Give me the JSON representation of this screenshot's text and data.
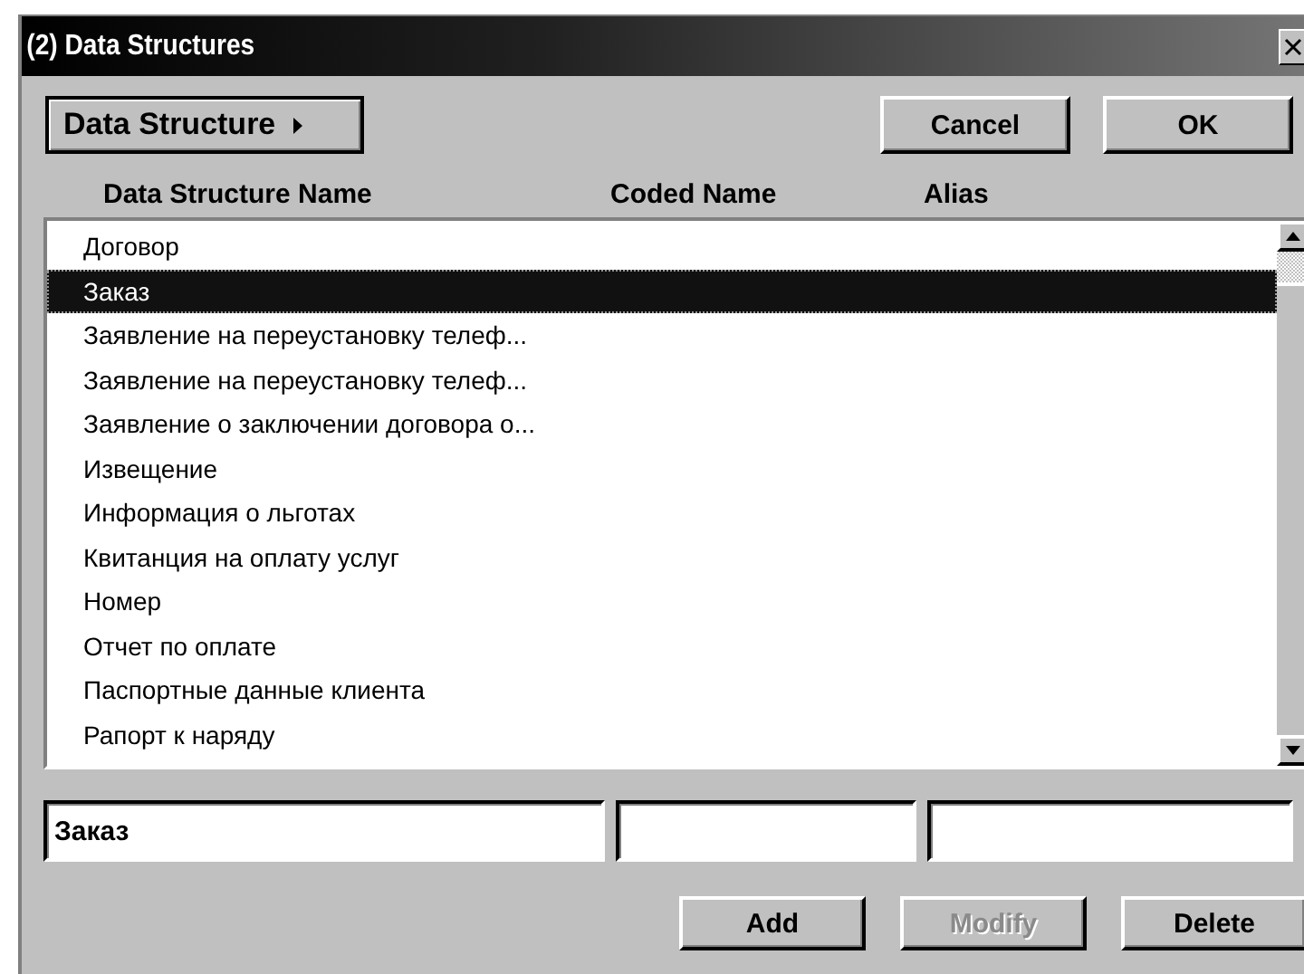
{
  "window": {
    "title": "(2) Data Structures"
  },
  "menu_button": {
    "label": "Data Structure",
    "has_submenu": true
  },
  "top_buttons": [
    {
      "label": "Cancel",
      "disabled": false
    },
    {
      "label": "OK",
      "disabled": false
    }
  ],
  "columns": [
    "Data Structure Name",
    "Coded Name",
    "Alias"
  ],
  "rows": [
    {
      "name": "Договор",
      "selected": false
    },
    {
      "name": "Заказ",
      "selected": true
    },
    {
      "name": "Заявление на переустановку телеф...",
      "selected": false
    },
    {
      "name": "Заявление на переустановку телеф...",
      "selected": false
    },
    {
      "name": "Заявление о заключении договора о...",
      "selected": false
    },
    {
      "name": "Извещение",
      "selected": false
    },
    {
      "name": "Информация о льготах",
      "selected": false
    },
    {
      "name": "Квитанция на оплату услуг",
      "selected": false
    },
    {
      "name": "Номер",
      "selected": false
    },
    {
      "name": "Отчет по оплате",
      "selected": false
    },
    {
      "name": "Паспортные данные клиента",
      "selected": false
    },
    {
      "name": "Рапорт к наряду",
      "selected": false
    }
  ],
  "fields": [
    {
      "kind": "text",
      "value": "Заказ"
    },
    {
      "kind": "text"
    },
    {
      "kind": "text"
    }
  ],
  "bottom_buttons": [
    {
      "label": "Add",
      "disabled": false
    },
    {
      "label": "Modify",
      "disabled": true
    },
    {
      "label": "Delete",
      "disabled": false
    }
  ]
}
